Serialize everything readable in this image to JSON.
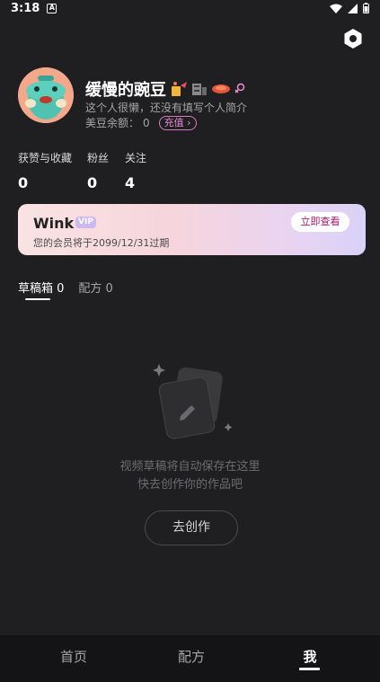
{
  "status_bar": {
    "time": "3:18",
    "notification": "A"
  },
  "profile": {
    "username": "缓慢的豌豆",
    "bio": "这个人很懒，还没有填写个人简介",
    "beans_label": "美豆余额：",
    "beans_value": "0",
    "recharge_label": "充值"
  },
  "stats": [
    {
      "label": "获赞与收藏",
      "value": "0"
    },
    {
      "label": "粉丝",
      "value": "0"
    },
    {
      "label": "关注",
      "value": "4"
    }
  ],
  "vip": {
    "brand": "Wink",
    "badge": "VIP",
    "expire_text": "您的会员将于2099/12/31过期",
    "button_label": "立即查看"
  },
  "tabs": [
    {
      "label": "草稿箱 0",
      "active": true
    },
    {
      "label": "配方 0",
      "active": false
    }
  ],
  "empty_state": {
    "line1": "视频草稿将自动保存在这里",
    "line2": "快去创作你的作品吧",
    "button_label": "去创作"
  },
  "bottom_nav": [
    {
      "label": "首页"
    },
    {
      "label": "配方"
    },
    {
      "label": "我",
      "active": true
    }
  ],
  "colors": {
    "background": "#1f1e20",
    "accent": "#e68ad6",
    "vip_button_text": "#b0176a"
  }
}
